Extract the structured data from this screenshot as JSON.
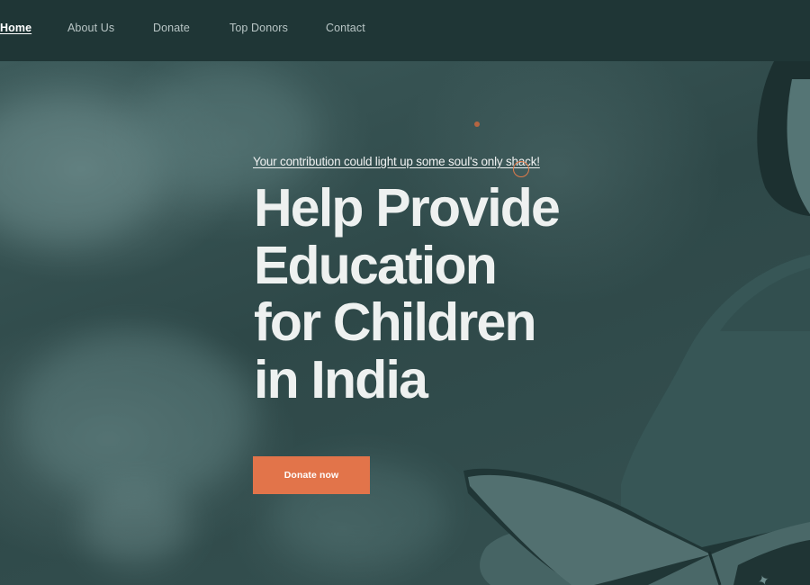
{
  "nav": {
    "items": [
      {
        "label": "Home",
        "active": true
      },
      {
        "label": "About Us",
        "active": false
      },
      {
        "label": "Donate",
        "active": false
      },
      {
        "label": "Top Donors",
        "active": false
      },
      {
        "label": "Contact",
        "active": false
      }
    ]
  },
  "hero": {
    "tagline": "Your contribution could light up some soul's only shack!",
    "headline_lines": [
      "Help Provide",
      "Education",
      "for Children",
      "in India"
    ],
    "cta_label": "Donate now"
  },
  "colors": {
    "nav_bg": "#1f3636",
    "hero_overlay": "#2f4a4a",
    "accent": "#e2744a",
    "text_light": "#eef1f0"
  }
}
